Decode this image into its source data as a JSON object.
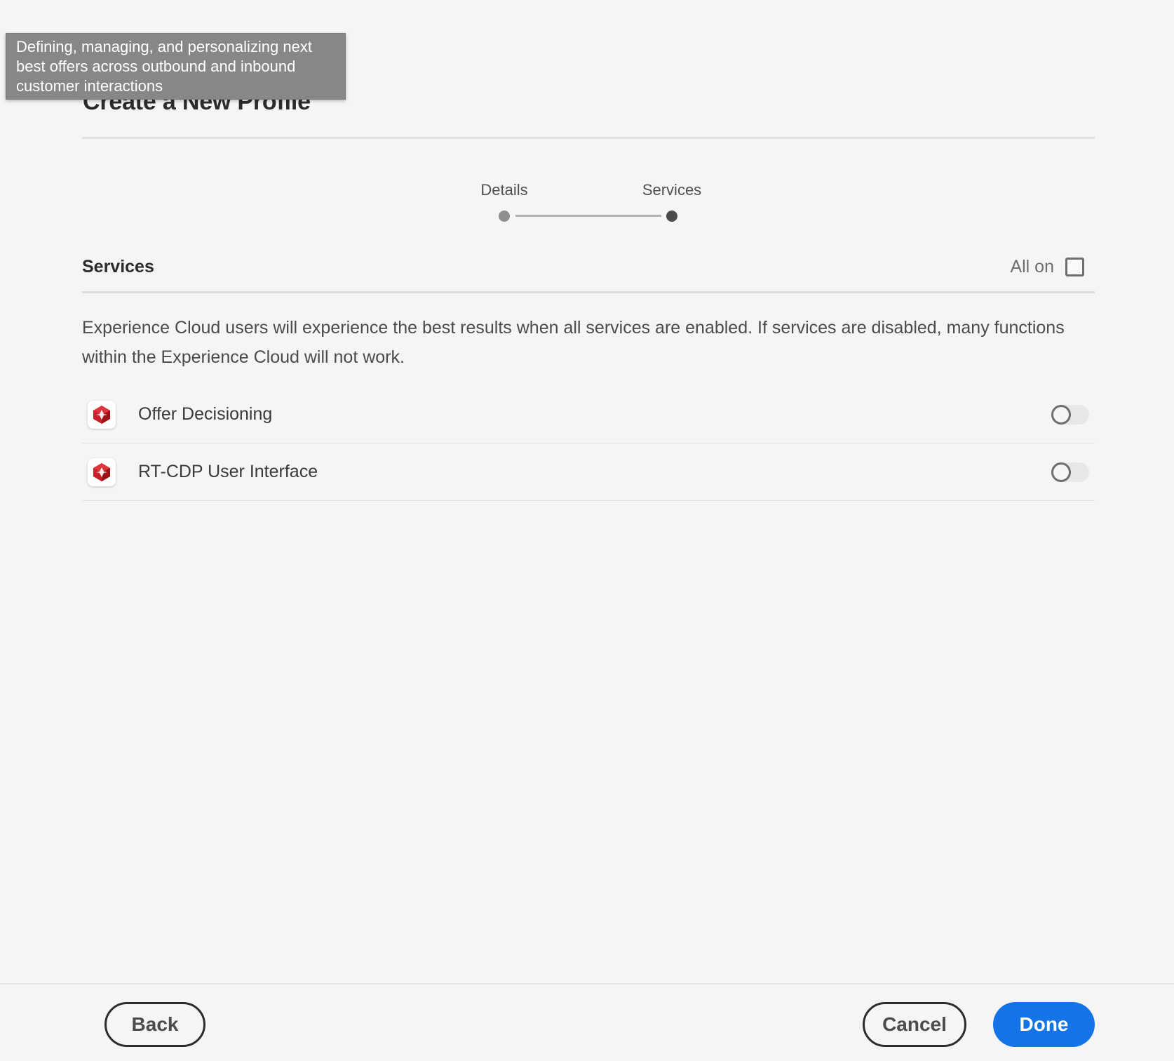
{
  "tooltip": {
    "line1": "Defining, managing, and personalizing next",
    "line2": "best offers across outbound and inbound",
    "line3": "customer interactions"
  },
  "page": {
    "title": "Create a New Profile"
  },
  "stepper": {
    "steps": [
      {
        "label": "Details",
        "state": "completed"
      },
      {
        "label": "Services",
        "state": "current"
      }
    ],
    "colors": {
      "completed": "#8e8e8e",
      "current": "#4b4b4b"
    }
  },
  "services_section": {
    "heading": "Services",
    "all_on_label": "All on",
    "all_on_checked": false,
    "description": "Experience Cloud users will experience the best results when all services are enabled. If services are disabled, many functions within the Experience Cloud will not work.",
    "items": [
      {
        "name": "Offer Decisioning",
        "icon": "adobe-experience-platform-icon",
        "enabled": false
      },
      {
        "name": "RT-CDP User Interface",
        "icon": "adobe-experience-platform-icon",
        "enabled": false
      }
    ]
  },
  "footer": {
    "back_label": "Back",
    "cancel_label": "Cancel",
    "done_label": "Done",
    "accent_color": "#1473e6"
  }
}
